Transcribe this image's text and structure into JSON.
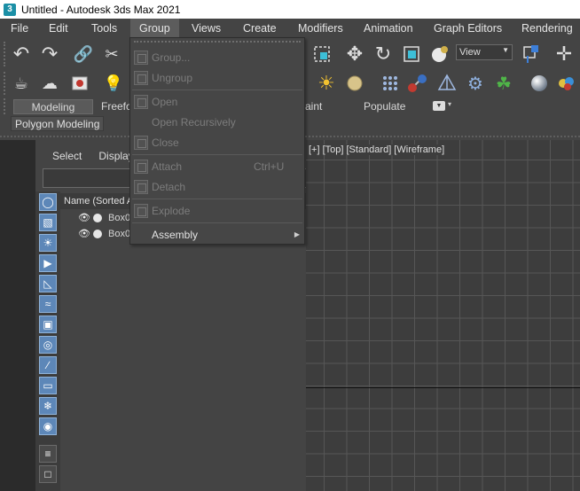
{
  "window": {
    "title": "Untitled - Autodesk 3ds Max 2021",
    "app_icon_glyph": "3"
  },
  "menubar": {
    "items": [
      {
        "label": "File"
      },
      {
        "label": "Edit"
      },
      {
        "label": "Tools"
      },
      {
        "label": "Group"
      },
      {
        "label": "Views"
      },
      {
        "label": "Create"
      },
      {
        "label": "Modifiers"
      },
      {
        "label": "Animation"
      },
      {
        "label": "Graph Editors"
      },
      {
        "label": "Rendering"
      }
    ],
    "active": "Group"
  },
  "toolbar": {
    "view_dropdown": "View"
  },
  "ribbon": {
    "tabs": [
      {
        "label": "Modeling"
      },
      {
        "label": "Freefo"
      },
      {
        "label": "aint"
      },
      {
        "label": "Populate"
      }
    ],
    "active": "Modeling",
    "sub_tab": "Polygon Modeling"
  },
  "explorer": {
    "tabs": [
      {
        "label": "Select"
      },
      {
        "label": "Display"
      }
    ],
    "column_header": "Name (Sorted Ascending)",
    "rows": [
      {
        "name": "Box001"
      },
      {
        "name": "Box002"
      }
    ]
  },
  "viewport": {
    "label": "[+] [Top] [Standard] [Wireframe]"
  },
  "group_menu": {
    "items": [
      {
        "label": "Group...",
        "enabled": false,
        "shortcut": ""
      },
      {
        "label": "Ungroup",
        "enabled": false,
        "shortcut": ""
      },
      {
        "label": "Open",
        "enabled": false,
        "shortcut": ""
      },
      {
        "label": "Open Recursively",
        "enabled": false,
        "shortcut": ""
      },
      {
        "label": "Close",
        "enabled": false,
        "shortcut": ""
      },
      {
        "label": "Attach",
        "enabled": false,
        "shortcut": "Ctrl+U"
      },
      {
        "label": "Detach",
        "enabled": false,
        "shortcut": ""
      },
      {
        "label": "Explode",
        "enabled": false,
        "shortcut": ""
      },
      {
        "label": "Assembly",
        "enabled": true,
        "shortcut": "",
        "submenu": true
      }
    ]
  },
  "colors": {
    "background": "#444444",
    "viewport": "#3d3d3d",
    "grid": "#565656",
    "accent_blue": "#5d87b8",
    "disabled_text": "#7c7c7c"
  }
}
